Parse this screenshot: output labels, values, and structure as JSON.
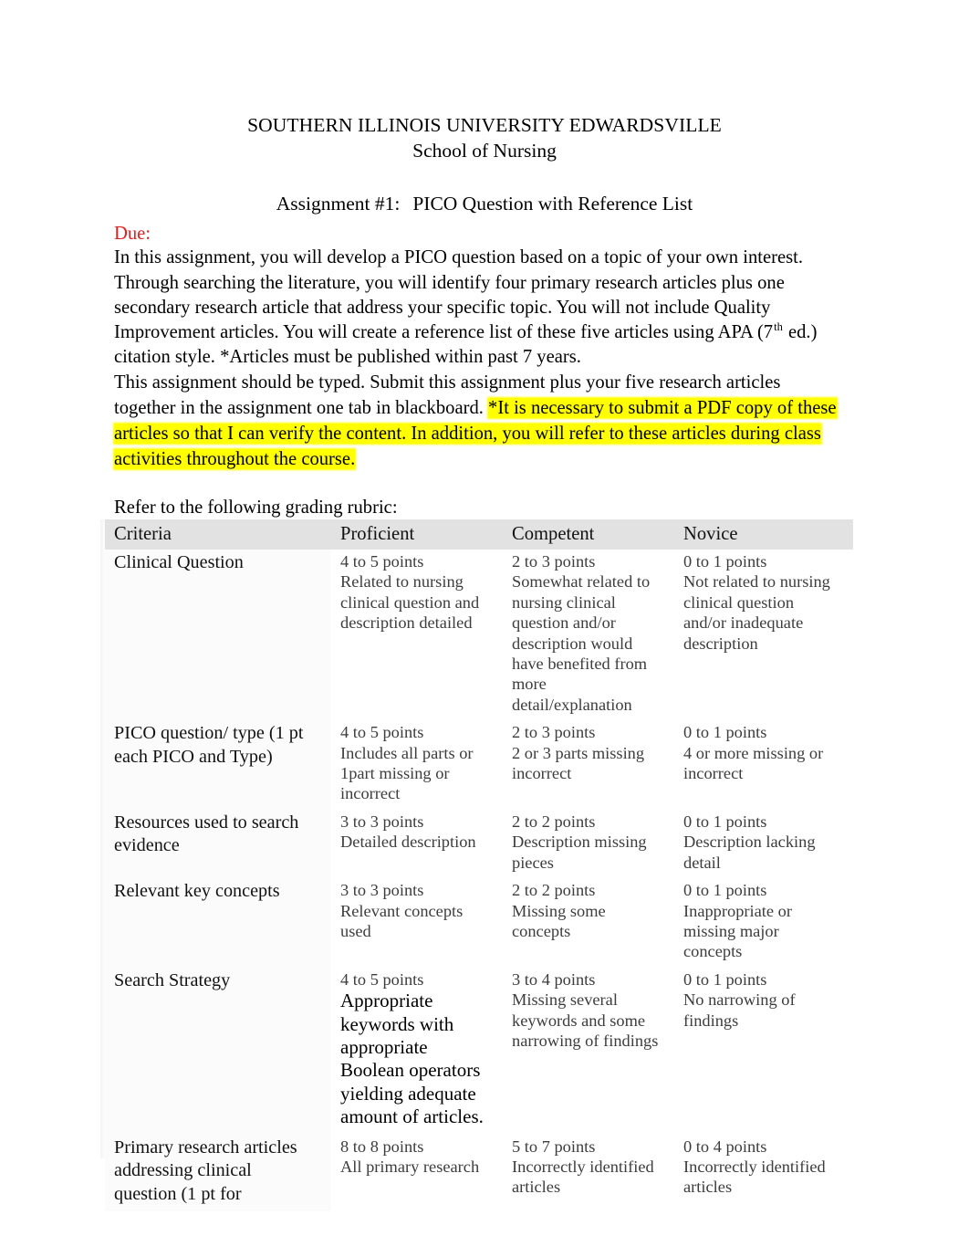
{
  "document": {
    "institution": "SOUTHERN ILLINOIS UNIVERSITY EDWARDSVILLE",
    "school": "School of Nursing",
    "assignment_label": "Assignment #1:",
    "assignment_title": "PICO Question with Reference List",
    "due_label": "Due:",
    "due_color": "#e12121",
    "highlight_color": "#ffff00"
  },
  "intro": {
    "line_1": "In this assignment, you will develop a PICO question based on a topic of your own interest.",
    "line_2": "Through searching the literature, you will identify four primary research articles plus one",
    "line_3": "secondary research article that address your specific topic. You will not include Quality",
    "line_4a": "Improvement articles.  You will create a reference list of these five articles using APA (7",
    "line_4_sup": "th",
    "line_4b": " ed.)",
    "line_5": "citation style.  *Articles must be published within past 7 years.",
    "line_6": "This assignment should be typed.  Submit this assignment plus your five research articles",
    "line_7a": "together in the assignment one tab in blackboard. ",
    "line_7b": "*It is necessary to submit a PDF copy of these",
    "line_8": "articles so that I can verify the content.   In addition, you will refer to these articles during class",
    "line_9": "activities throughout the course."
  },
  "rubric": {
    "intro": "Refer to the following grading rubric:",
    "headers": [
      "Criteria",
      "Proficient",
      "Competent",
      "Novice"
    ],
    "rows": [
      {
        "criteria": "Clinical Question",
        "proficient": {
          "points": "4 to 5 points",
          "description": "Related to nursing clinical question and description detailed"
        },
        "competent": {
          "points": "2 to 3 points",
          "description": "Somewhat related to nursing clinical question and/or description would have benefited from more detail/explanation"
        },
        "novice": {
          "points": "0 to 1 points",
          "description": "Not related to nursing clinical question and/or inadequate description"
        }
      },
      {
        "criteria": "PICO question/ type (1 pt each PICO and Type)",
        "proficient": {
          "points": "4 to 5 points",
          "description": "Includes all parts or 1part missing or incorrect"
        },
        "competent": {
          "points": "2 to 3 points",
          "description": "2 or 3 parts missing incorrect"
        },
        "novice": {
          "points": "0 to 1 points",
          "description": "4 or more missing or incorrect"
        }
      },
      {
        "criteria": "Resources used to search evidence",
        "proficient": {
          "points": "3 to 3 points",
          "description": "Detailed description"
        },
        "competent": {
          "points": "2 to 2 points",
          "description": "Description missing pieces"
        },
        "novice": {
          "points": "0 to 1 points",
          "description": "Description lacking detail"
        }
      },
      {
        "criteria": "Relevant key concepts",
        "proficient": {
          "points": "3 to 3 points",
          "description": "Relevant concepts used"
        },
        "competent": {
          "points": "2 to 2 points",
          "description": "Missing some concepts"
        },
        "novice": {
          "points": "0 to 1 points",
          "description": "Inappropriate or missing major concepts"
        }
      },
      {
        "criteria": "Search Strategy",
        "proficient": {
          "points": "4 to 5 points",
          "description": "Appropriate keywords with appropriate Boolean operators yielding adequate amount of articles."
        },
        "competent": {
          "points": "3 to 4 points",
          "description": "Missing several keywords and some narrowing of findings"
        },
        "novice": {
          "points": "0 to 1 points",
          "description": "No narrowing of findings"
        }
      },
      {
        "criteria": "Primary research articles addressing clinical question (1 pt for",
        "proficient": {
          "points": "8 to 8 points",
          "description": "All primary research"
        },
        "competent": {
          "points": "5 to 7 points",
          "description": "Incorrectly identified articles"
        },
        "novice": {
          "points": "0 to 4 points",
          "description": "Incorrectly identified articles"
        }
      }
    ]
  }
}
